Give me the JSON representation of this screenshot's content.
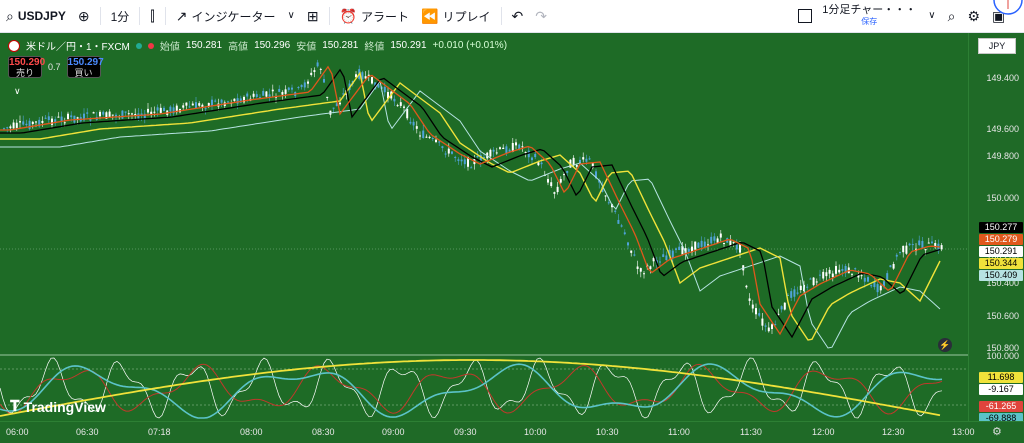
{
  "toolbar": {
    "symbol": "USDJPY",
    "interval": "1分",
    "indicators_label": "インジケーター",
    "alert_label": "アラート",
    "replay_label": "リプレイ",
    "layout_name": "1分足チャー・・・",
    "layout_saved": "保存"
  },
  "legend": {
    "title": "米ドル／円・1・FXCM",
    "open_k": "始値",
    "open_v": "150.281",
    "high_k": "高値",
    "high_v": "150.296",
    "low_k": "安値",
    "low_v": "150.281",
    "close_k": "終値",
    "close_v": "150.291",
    "change": "+0.010 (+0.01%)"
  },
  "trade": {
    "sell_price": "150.290",
    "sell_label": "売り",
    "spread": "0.7",
    "buy_price": "150.297",
    "buy_label": "買い"
  },
  "currency": "JPY",
  "price_axis": [
    "149.400",
    "149.600",
    "149.800",
    "150.000",
    "150.200",
    "150.400",
    "150.600",
    "150.800"
  ],
  "price_tags": [
    {
      "value": "150.277",
      "bg": "#000000",
      "fg": "#ffffff"
    },
    {
      "value": "150.279",
      "bg": "#e0581c",
      "fg": "#ffffff"
    },
    {
      "value": "150.291",
      "bg": "#ffffff",
      "fg": "#000000"
    },
    {
      "value": "150.344",
      "bg": "#f0e23a",
      "fg": "#000000"
    },
    {
      "value": "150.409",
      "bg": "#b6e3e3",
      "fg": "#000000"
    }
  ],
  "osc_axis": [
    "100.000"
  ],
  "osc_tags": [
    {
      "value": "11.698",
      "bg": "#f0e23a",
      "fg": "#000000"
    },
    {
      "value": "-9.167",
      "bg": "#ffffff",
      "fg": "#000000"
    },
    {
      "value": "-61.265",
      "bg": "#e0443c",
      "fg": "#ffffff"
    },
    {
      "value": "-69.888",
      "bg": "#5bc3c8",
      "fg": "#000000"
    }
  ],
  "time_axis": [
    "06:00",
    "06:30",
    "07:18",
    "08:00",
    "08:30",
    "09:00",
    "09:30",
    "10:00",
    "10:30",
    "11:00",
    "11:30",
    "12:00",
    "12:30",
    "13:00"
  ],
  "brand": "TradingView",
  "colors": {
    "background": "#1e6b26",
    "ema_fast": "#e0581c",
    "ema_black": "#000000",
    "ema_yellow": "#f0e23a",
    "ema_cyan": "#b6e3e3",
    "candle_up": "#ffffff",
    "candle_down": "#4fa3d9"
  }
}
